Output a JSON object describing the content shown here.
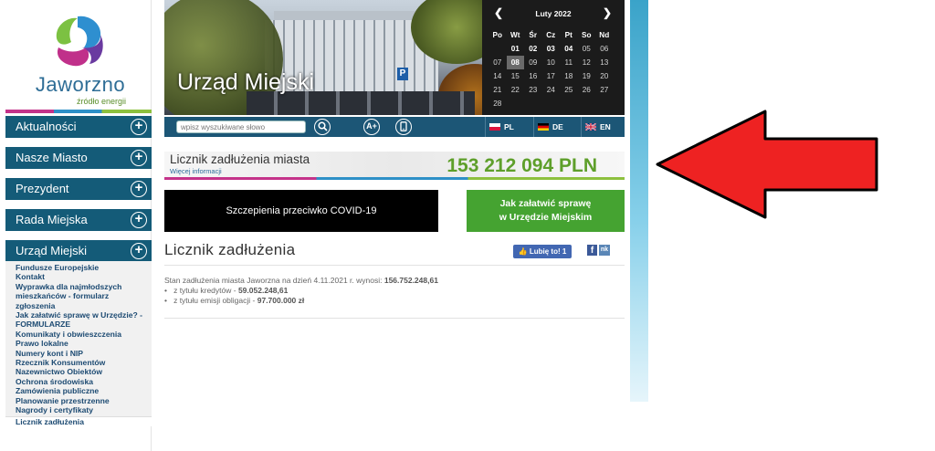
{
  "logo": {
    "name": "Jaworzno",
    "tagline": "źródło energii"
  },
  "nav": [
    {
      "label": "Aktualności"
    },
    {
      "label": "Nasze Miasto"
    },
    {
      "label": "Prezydent"
    },
    {
      "label": "Rada Miejska"
    },
    {
      "label": "Urząd Miejski"
    }
  ],
  "submenu": [
    "Fundusze Europejskie",
    "Kontakt",
    "Wyprawka dla najmłodszych mieszkańców - formularz zgłoszenia",
    "Jak załatwić sprawę w Urzędzie? - FORMULARZE",
    "Komunikaty i obwieszczenia",
    "Prawo lokalne",
    "Numery kont i NIP",
    "Rzecznik Konsumentów",
    "Nazewnictwo Obiektów",
    "Ochrona środowiska",
    "Zamówienia publiczne",
    "Planowanie przestrzenne",
    "Nagrody i certyfikaty",
    "Licznik zadłużenia"
  ],
  "hero": {
    "title": "Urząd Miejski",
    "sign": "P"
  },
  "calendar": {
    "month": "Luty 2022",
    "prev": "❮",
    "next": "❯",
    "days_of_week": [
      "Po",
      "Wt",
      "Śr",
      "Cz",
      "Pt",
      "So",
      "Nd"
    ],
    "weeks": [
      [
        "",
        "01",
        "02",
        "03",
        "04",
        "05",
        "06"
      ],
      [
        "07",
        "08",
        "09",
        "10",
        "11",
        "12",
        "13"
      ],
      [
        "14",
        "15",
        "16",
        "17",
        "18",
        "19",
        "20"
      ],
      [
        "21",
        "22",
        "23",
        "24",
        "25",
        "26",
        "27"
      ],
      [
        "28",
        "",
        "",
        "",
        "",
        "",
        ""
      ]
    ],
    "today": "08"
  },
  "toolbar": {
    "search_placeholder": "wpisz wyszukiwane słowo",
    "font_label": "A+",
    "languages": [
      "PL",
      "DE",
      "EN"
    ]
  },
  "debt": {
    "label": "Licznik zadłużenia miasta",
    "more": "Więcej informacji",
    "amount": "153 212 094 PLN"
  },
  "buttons": {
    "covid": "Szczepienia przeciwko COVID-19",
    "howto_line1": "Jak załatwić sprawę",
    "howto_line2": "w Urzędzie Miejskim"
  },
  "content": {
    "title": "Licznik zadłużenia",
    "like": "Lubię to! 1",
    "fb": "f",
    "nk": "nk",
    "intro": "Stan zadłużenia miasta Jaworzna na dzień 4.11.2021 r. wynosi:",
    "total": "156.752.248,61",
    "credits_label": "z tytułu kredytów -",
    "credits_value": "59.052.248,61",
    "bonds_label": "z tytułu emisji obligacji -",
    "bonds_value": "97.700.000 zł"
  },
  "colors": {
    "nav": "#145b78",
    "green": "#5e9f2a",
    "arrow": "#ee2222"
  }
}
